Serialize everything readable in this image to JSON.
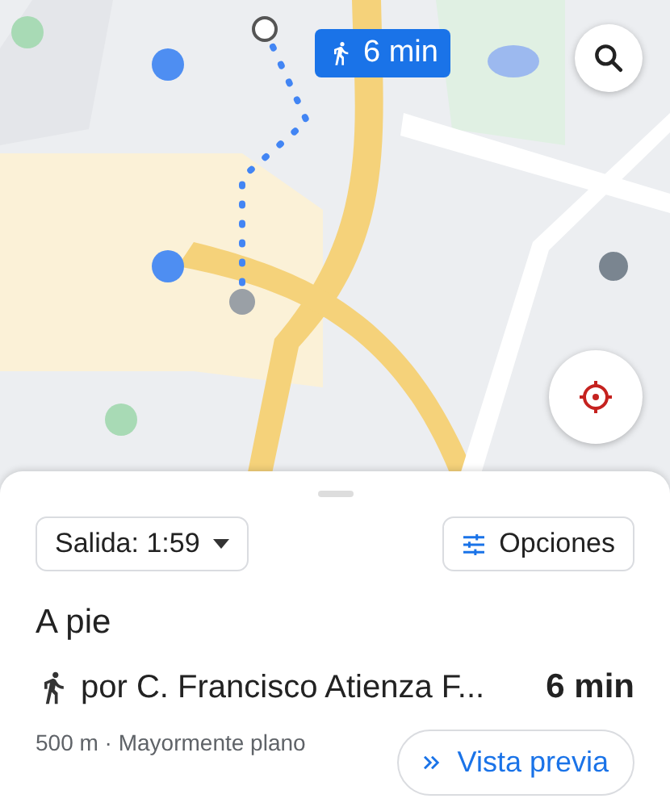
{
  "map": {
    "route_chip": {
      "duration": "6 min"
    }
  },
  "sheet": {
    "departure": "Salida: 1:59",
    "options": "Opciones",
    "mode": "A pie",
    "route": {
      "via": "por C. Francisco Atienza F...",
      "duration": "6 min",
      "details": "500 m · Mayormente plano"
    },
    "preview": "Vista previa"
  }
}
